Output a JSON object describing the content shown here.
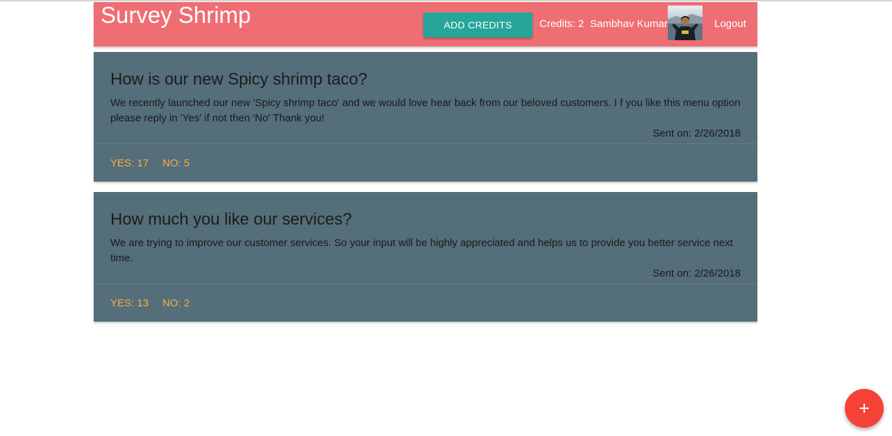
{
  "app": {
    "brand": "Survey Shrimp",
    "add_credits_label": "ADD CREDITS",
    "credits_text": "Credits: 2",
    "user_name": "Sambhav Kumar",
    "logout_label": "Logout"
  },
  "surveys": [
    {
      "title": "How is our new Spicy shrimp taco?",
      "body": "We recently launched our new 'Spicy shrimp taco' and we would love hear back from our beloved customers. I f you like this menu option please reply in 'Yes' if not then 'No' Thank you!",
      "sent_on": "Sent on: 2/26/2018",
      "yes": "YES: 17",
      "no": "NO: 5"
    },
    {
      "title": "How much you like our services?",
      "body": "We are trying to improve our customer services. So your input will be highly appreciated and helps us to provide you better service next time.",
      "sent_on": "Sent on: 2/26/2018",
      "yes": "YES: 13",
      "no": "NO: 2"
    }
  ],
  "fab": {
    "icon": "plus-icon"
  },
  "colors": {
    "navbar": "#ef6e73",
    "add_credits_button": "#26a69a",
    "card": "#546e7a",
    "vote_text": "#ffab40",
    "fab": "#f44336"
  }
}
